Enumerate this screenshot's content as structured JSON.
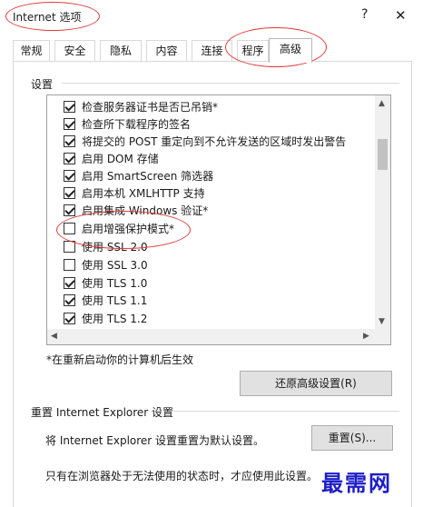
{
  "window": {
    "title": "Internet 选项",
    "help_glyph": "?",
    "close_glyph": "✕"
  },
  "tabs": [
    "常规",
    "安全",
    "隐私",
    "内容",
    "连接",
    "程序",
    "高级"
  ],
  "settings": {
    "label": "设置",
    "items": [
      {
        "label": "检查服务器证书是否已吊销*",
        "checked": true
      },
      {
        "label": "检查所下载程序的签名",
        "checked": true
      },
      {
        "label": "将提交的 POST 重定向到不允许发送的区域时发出警告",
        "checked": true
      },
      {
        "label": "启用 DOM 存储",
        "checked": true
      },
      {
        "label": "启用 SmartScreen 筛选器",
        "checked": true
      },
      {
        "label": "启用本机 XMLHTTP 支持",
        "checked": true
      },
      {
        "label": "启用集成 Windows 验证*",
        "checked": true
      },
      {
        "label": "启用增强保护模式*",
        "checked": false
      },
      {
        "label": "使用 SSL 2.0",
        "checked": false
      },
      {
        "label": "使用 SSL 3.0",
        "checked": false
      },
      {
        "label": "使用 TLS 1.0",
        "checked": true
      },
      {
        "label": "使用 TLS 1.1",
        "checked": true
      },
      {
        "label": "使用 TLS 1.2",
        "checked": true
      }
    ],
    "scroll_up": "▲",
    "scroll_down": "▼",
    "scroll_left": "◀",
    "scroll_right": "▶"
  },
  "restart_note": "*在重新启动你的计算机后生效",
  "restore_button": "还原高级设置(R)",
  "reset": {
    "title": "重置 Internet Explorer 设置",
    "description": "将 Internet Explorer 设置重置为默认设置。",
    "button": "重置(S)...",
    "note": "只有在浏览器处于无法使用的状态时，才应使用此设置。"
  },
  "watermark": "最需网",
  "colors": {
    "annotation": "#e23a3a",
    "watermark": "#1e1ec8"
  }
}
